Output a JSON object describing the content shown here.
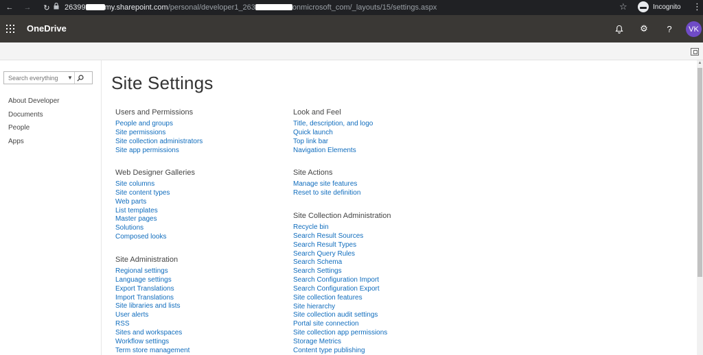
{
  "browser": {
    "back_glyph": "←",
    "forward_glyph": "→",
    "reload_glyph": "↻",
    "url_host_start": "26399",
    "url_host_end": "my.sharepoint.com",
    "url_path_start": "/personal/developer1_263",
    "url_path_end": "onmicrosoft_com/_layouts/15/settings.aspx",
    "star_glyph": "☆",
    "incognito_label": "Incognito",
    "menu_glyph": "⋮"
  },
  "suite": {
    "app_name": "OneDrive",
    "bell_glyph": "🔔",
    "gear_glyph": "⚙",
    "help_glyph": "?",
    "avatar_initials": "VK",
    "avatar_color": "#6f4bc6"
  },
  "left_nav": {
    "search_placeholder": "Search everything",
    "search_caret": "▼",
    "search_glyph": "⌕",
    "items": [
      "About Developer",
      "Documents",
      "People",
      "Apps"
    ]
  },
  "main": {
    "title": "Site Settings",
    "sections": [
      {
        "title": "Users and Permissions",
        "links": [
          "People and groups",
          "Site permissions",
          "Site collection administrators",
          "Site app permissions"
        ]
      },
      {
        "title": "Web Designer Galleries",
        "links": [
          "Site columns",
          "Site content types",
          "Web parts",
          "List templates",
          "Master pages",
          "Solutions",
          "Composed looks"
        ]
      },
      {
        "title": "Site Administration",
        "links": [
          "Regional settings",
          "Language settings",
          "Export Translations",
          "Import Translations",
          "Site libraries and lists",
          "User alerts",
          "RSS",
          "Sites and workspaces",
          "Workflow settings",
          "Term store management"
        ]
      },
      {
        "title": "Look and Feel",
        "links": [
          "Title, description, and logo",
          "Quick launch",
          "Top link bar",
          "Navigation Elements"
        ]
      },
      {
        "title": "Site Actions",
        "links": [
          "Manage site features",
          "Reset to site definition"
        ]
      },
      {
        "title": "Site Collection Administration",
        "links": [
          "Recycle bin",
          "Search Result Sources",
          "Search Result Types",
          "Search Query Rules",
          "Search Schema",
          "Search Settings",
          "Search Configuration Import",
          "Search Configuration Export",
          "Site collection features",
          "Site hierarchy",
          "Site collection audit settings",
          "Portal site connection",
          "Site collection app permissions",
          "Storage Metrics",
          "Content type publishing"
        ]
      }
    ]
  },
  "colors": {
    "link": "#0f6cbd",
    "suite_bar": "#3a3835",
    "browser_bar": "#202124"
  }
}
